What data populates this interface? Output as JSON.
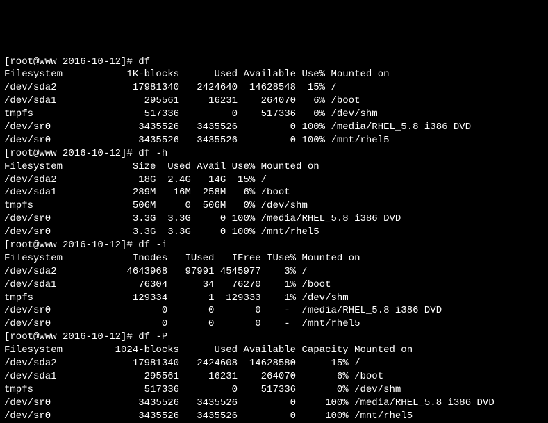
{
  "prompts": {
    "p1": {
      "bracketOpen": "[",
      "user": "root@www 2016-10-12",
      "bracketClose": "]#",
      "cmd": "df"
    },
    "p2": {
      "bracketOpen": "[",
      "user": "root@www 2016-10-12",
      "bracketClose": "]#",
      "cmd": "df -h"
    },
    "p3": {
      "bracketOpen": "[",
      "user": "root@www 2016-10-12",
      "bracketClose": "]#",
      "cmd": "df -i"
    },
    "p4": {
      "bracketOpen": "[",
      "user": "root@www 2016-10-12",
      "bracketClose": "]#",
      "cmd": "df -P"
    }
  },
  "df1": {
    "header": "Filesystem           1K-blocks      Used Available Use% Mounted on",
    "rows": [
      "/dev/sda2             17981340   2424640  14628548  15% /",
      "/dev/sda1               295561     16231    264070   6% /boot",
      "tmpfs                   517336         0    517336   0% /dev/shm",
      "/dev/sr0               3435526   3435526         0 100% /media/RHEL_5.8 i386 DVD",
      "/dev/sr0               3435526   3435526         0 100% /mnt/rhel5"
    ]
  },
  "df2": {
    "header": "Filesystem            Size  Used Avail Use% Mounted on",
    "rows": [
      "/dev/sda2              18G  2.4G   14G  15% /",
      "/dev/sda1             289M   16M  258M   6% /boot",
      "tmpfs                 506M     0  506M   0% /dev/shm",
      "/dev/sr0              3.3G  3.3G     0 100% /media/RHEL_5.8 i386 DVD",
      "/dev/sr0              3.3G  3.3G     0 100% /mnt/rhel5"
    ]
  },
  "df3": {
    "header": "Filesystem            Inodes   IUsed   IFree IUse% Mounted on",
    "rows": [
      "/dev/sda2            4643968   97991 4545977    3% /",
      "/dev/sda1              76304      34   76270    1% /boot",
      "tmpfs                 129334       1  129333    1% /dev/shm",
      "/dev/sr0                   0       0       0    -  /media/RHEL_5.8 i386 DVD",
      "/dev/sr0                   0       0       0    -  /mnt/rhel5"
    ]
  },
  "df4": {
    "header": "Filesystem         1024-blocks      Used Available Capacity Mounted on",
    "rows": [
      "/dev/sda2             17981340   2424608  14628580      15% /",
      "/dev/sda1               295561     16231    264070       6% /boot",
      "tmpfs                   517336         0    517336       0% /dev/shm",
      "/dev/sr0               3435526   3435526         0     100% /media/RHEL_5.8 i386 DVD",
      "/dev/sr0               3435526   3435526         0     100% /mnt/rhel5"
    ]
  },
  "space": " "
}
